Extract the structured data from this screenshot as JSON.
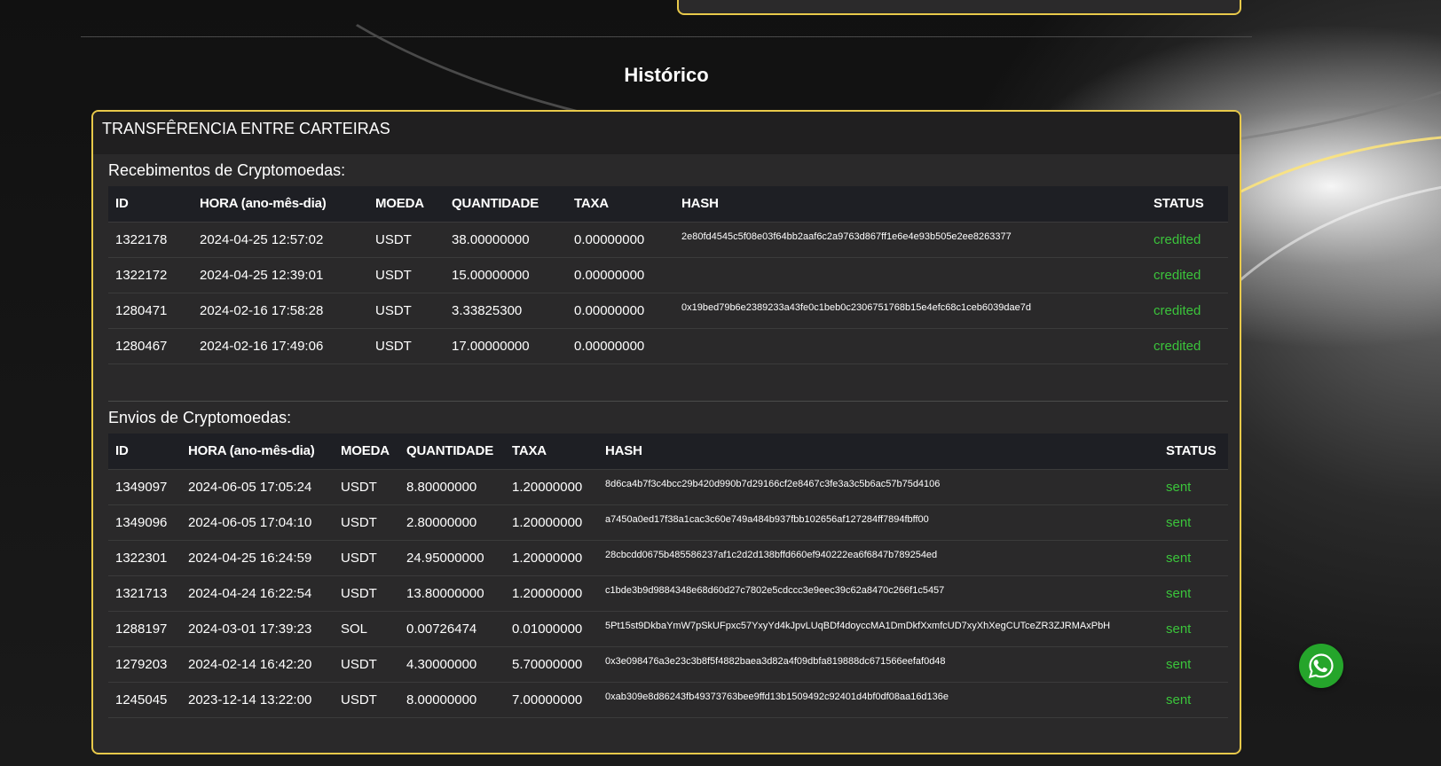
{
  "page": {
    "title": "Histórico"
  },
  "card": {
    "header": "TRANSFÊRENCIA ENTRE CARTEIRAS"
  },
  "received": {
    "title": "Recebimentos de Cryptomoedas:",
    "columns": [
      "ID",
      "HORA (ano-mês-dia)",
      "MOEDA",
      "QUANTIDADE",
      "TAXA",
      "HASH",
      "STATUS"
    ],
    "rows": [
      {
        "id": "1322178",
        "time": "2024-04-25 12:57:02",
        "coin": "USDT",
        "amount": "38.00000000",
        "fee": "0.00000000",
        "hash": "2e80fd4545c5f08e03f64bb2aaf6c2a9763d867ff1e6e4e93b505e2ee8263377",
        "status": "credited"
      },
      {
        "id": "1322172",
        "time": "2024-04-25 12:39:01",
        "coin": "USDT",
        "amount": "15.00000000",
        "fee": "0.00000000",
        "hash": "",
        "status": "credited"
      },
      {
        "id": "1280471",
        "time": "2024-02-16 17:58:28",
        "coin": "USDT",
        "amount": "3.33825300",
        "fee": "0.00000000",
        "hash": "0x19bed79b6e2389233a43fe0c1beb0c2306751768b15e4efc68c1ceb6039dae7d",
        "status": "credited"
      },
      {
        "id": "1280467",
        "time": "2024-02-16 17:49:06",
        "coin": "USDT",
        "amount": "17.00000000",
        "fee": "0.00000000",
        "hash": "",
        "status": "credited"
      }
    ]
  },
  "sent": {
    "title": "Envios de Cryptomoedas:",
    "columns": [
      "ID",
      "HORA (ano-mês-dia)",
      "MOEDA",
      "QUANTIDADE",
      "TAXA",
      "HASH",
      "STATUS"
    ],
    "rows": [
      {
        "id": "1349097",
        "time": "2024-06-05 17:05:24",
        "coin": "USDT",
        "amount": "8.80000000",
        "fee": "1.20000000",
        "hash": "8d6ca4b7f3c4bcc29b420d990b7d29166cf2e8467c3fe3a3c5b6ac57b75d4106",
        "status": "sent"
      },
      {
        "id": "1349096",
        "time": "2024-06-05 17:04:10",
        "coin": "USDT",
        "amount": "2.80000000",
        "fee": "1.20000000",
        "hash": "a7450a0ed17f38a1cac3c60e749a484b937fbb102656af127284ff7894fbff00",
        "status": "sent"
      },
      {
        "id": "1322301",
        "time": "2024-04-25 16:24:59",
        "coin": "USDT",
        "amount": "24.95000000",
        "fee": "1.20000000",
        "hash": "28cbcdd0675b485586237af1c2d2d138bffd660ef940222ea6f6847b789254ed",
        "status": "sent"
      },
      {
        "id": "1321713",
        "time": "2024-04-24 16:22:54",
        "coin": "USDT",
        "amount": "13.80000000",
        "fee": "1.20000000",
        "hash": "c1bde3b9d9884348e68d60d27c7802e5cdccc3e9eec39c62a8470c266f1c5457",
        "status": "sent"
      },
      {
        "id": "1288197",
        "time": "2024-03-01 17:39:23",
        "coin": "SOL",
        "amount": "0.00726474",
        "fee": "0.01000000",
        "hash": "5Pt15st9DkbaYmW7pSkUFpxc57YxyYd4kJpvLUqBDf4doyccMA1DmDkfXxmfcUD7xyXhXegCUTceZR3ZJRMAxPbH",
        "status": "sent"
      },
      {
        "id": "1279203",
        "time": "2024-02-14 16:42:20",
        "coin": "USDT",
        "amount": "4.30000000",
        "fee": "5.70000000",
        "hash": "0x3e098476a3e23c3b8f5f4882baea3d82a4f09dbfa819888dc671566eefaf0d48",
        "status": "sent"
      },
      {
        "id": "1245045",
        "time": "2023-12-14 13:22:00",
        "coin": "USDT",
        "amount": "8.00000000",
        "fee": "7.00000000",
        "hash": "0xab309e8d86243fb49373763bee9ffd13b1509492c92401d4bf0df08aa16d136e",
        "status": "sent"
      }
    ]
  },
  "whatsapp": {
    "icon": "whatsapp-icon",
    "color": "#25a52b"
  },
  "colors": {
    "accent": "#e8c94a",
    "status_ok": "#3bc43b"
  }
}
